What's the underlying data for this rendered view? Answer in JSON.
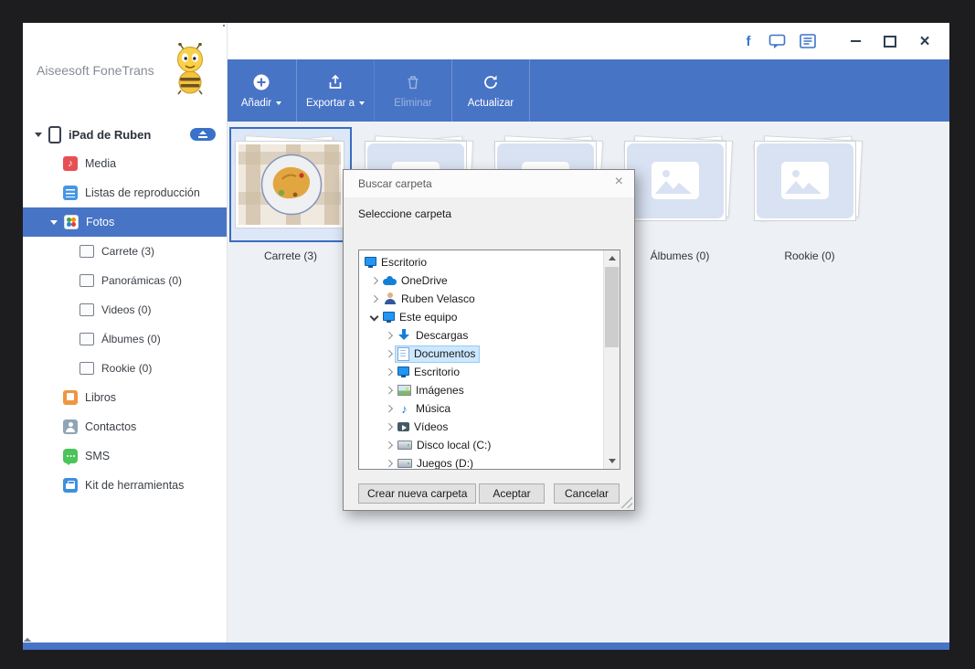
{
  "icons": {
    "facebook": "f",
    "close": "×",
    "note": "♪"
  },
  "app": {
    "brand": "Aiseesoft FoneTrans"
  },
  "toolbar": {
    "buttons": [
      {
        "label": "Añadir",
        "icon": "add-icon",
        "dropdown": true,
        "enabled": true
      },
      {
        "label": "Exportar a",
        "icon": "export-icon",
        "dropdown": true,
        "enabled": true
      },
      {
        "label": "Eliminar",
        "icon": "trash-icon",
        "dropdown": false,
        "enabled": false
      },
      {
        "label": "Actualizar",
        "icon": "refresh-icon",
        "dropdown": false,
        "enabled": true
      }
    ]
  },
  "sidebar": {
    "device": {
      "label": "iPad de Ruben",
      "ejectable": true
    },
    "items": [
      {
        "label": "Media",
        "icon": "music-icon"
      },
      {
        "label": "Listas de reproducción",
        "icon": "playlist-icon"
      },
      {
        "label": "Fotos",
        "icon": "photos-icon",
        "selected": true
      },
      {
        "label": "Carrete (3)",
        "icon": "camera-roll-icon",
        "indent": true
      },
      {
        "label": "Panorámicas (0)",
        "icon": "panorama-icon",
        "indent": true
      },
      {
        "label": "Videos (0)",
        "icon": "video-icon",
        "indent": true
      },
      {
        "label": "Álbumes (0)",
        "icon": "album-icon",
        "indent": true
      },
      {
        "label": "Rookie (0)",
        "icon": "album-icon",
        "indent": true
      },
      {
        "label": "Libros",
        "icon": "books-icon"
      },
      {
        "label": "Contactos",
        "icon": "contacts-icon"
      },
      {
        "label": "SMS",
        "icon": "sms-icon"
      },
      {
        "label": "Kit de herramientas",
        "icon": "toolkit-icon"
      }
    ]
  },
  "albums": {
    "items": [
      {
        "label": "Carrete (3)",
        "selected": true,
        "thumb": "food-photo"
      },
      {
        "label": "",
        "thumb": "placeholder"
      },
      {
        "label": "",
        "thumb": "placeholder"
      },
      {
        "label": "Álbumes (0)",
        "thumb": "placeholder"
      },
      {
        "label": "Rookie (0)",
        "thumb": "placeholder"
      }
    ]
  },
  "dialog": {
    "title": "Buscar carpeta",
    "subtitle": "Seleccione carpeta",
    "tree": [
      {
        "label": "Escritorio",
        "level": 0,
        "icon": "desktop-icon",
        "expand": "none"
      },
      {
        "label": "OneDrive",
        "level": 1,
        "icon": "onedrive-icon",
        "expand": "collapsed"
      },
      {
        "label": "Ruben Velasco",
        "level": 1,
        "icon": "user-icon",
        "expand": "collapsed"
      },
      {
        "label": "Este equipo",
        "level": 1,
        "icon": "computer-icon",
        "expand": "expanded"
      },
      {
        "label": "Descargas",
        "level": 2,
        "icon": "downloads-icon",
        "expand": "collapsed"
      },
      {
        "label": "Documentos",
        "level": 2,
        "icon": "documents-icon",
        "expand": "collapsed",
        "selected": true
      },
      {
        "label": "Escritorio",
        "level": 2,
        "icon": "desktop-icon",
        "expand": "collapsed"
      },
      {
        "label": "Imágenes",
        "level": 2,
        "icon": "pictures-icon",
        "expand": "collapsed"
      },
      {
        "label": "Música",
        "level": 2,
        "icon": "music-icon",
        "expand": "collapsed"
      },
      {
        "label": "Vídeos",
        "level": 2,
        "icon": "videos-icon",
        "expand": "collapsed"
      },
      {
        "label": "Disco local (C:)",
        "level": 2,
        "icon": "drive-icon",
        "expand": "collapsed"
      },
      {
        "label": "Juegos (D:)",
        "level": 2,
        "icon": "drive-icon",
        "expand": "collapsed"
      }
    ],
    "buttons": {
      "new_folder": "Crear nueva carpeta",
      "accept": "Aceptar",
      "cancel": "Cancelar"
    }
  }
}
